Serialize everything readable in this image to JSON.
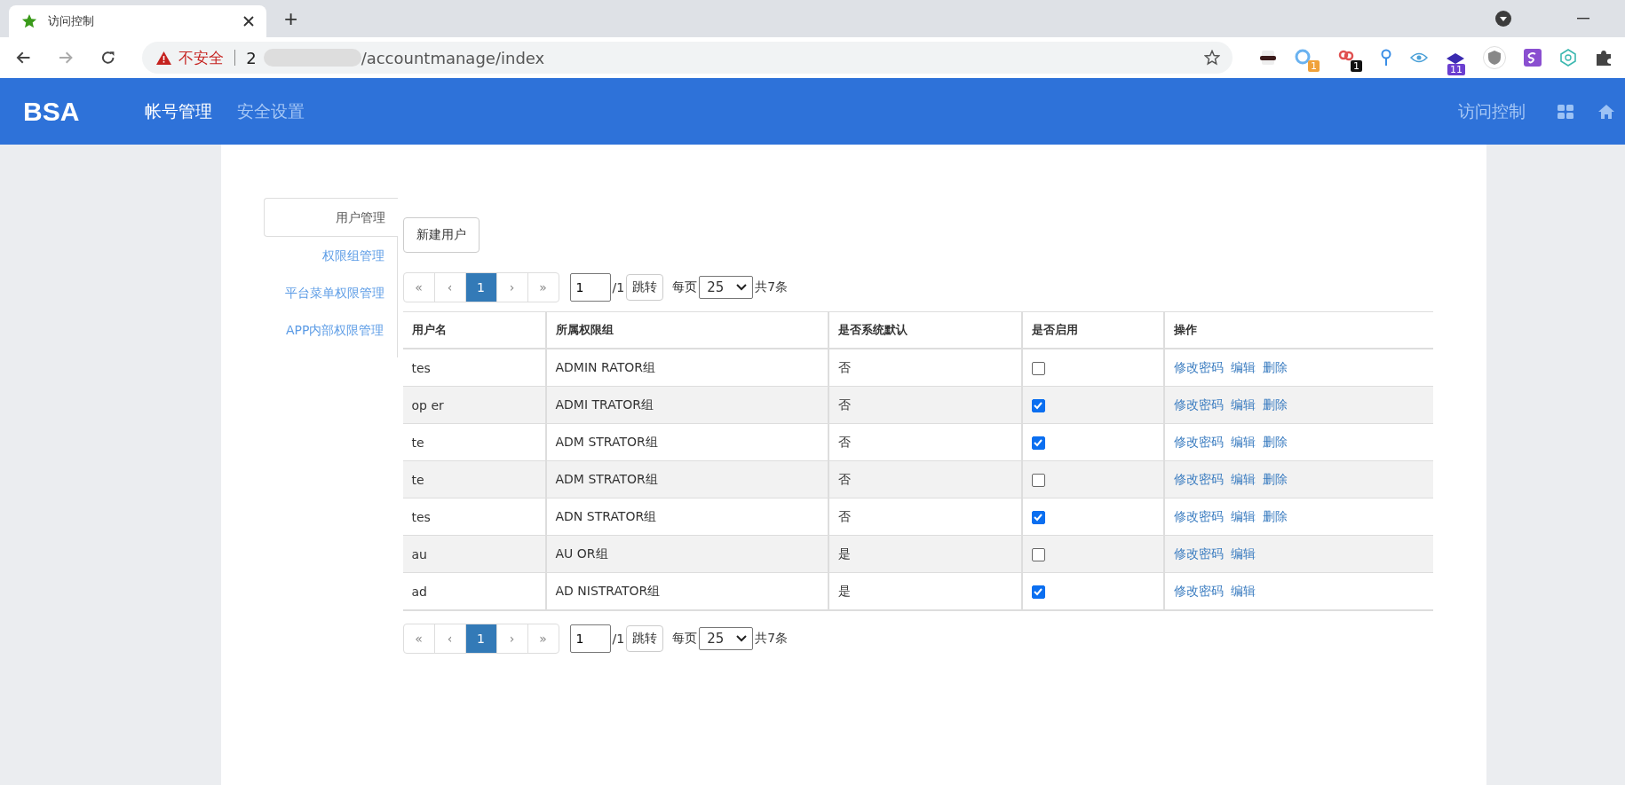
{
  "browser": {
    "tab_title": "访问控制",
    "new_tab": "+",
    "url_warning": "不安全",
    "url_host": "2",
    "url_path": "/accountmanage/index",
    "extension_badges": [
      "1",
      "1",
      "11"
    ]
  },
  "header": {
    "logo": "BSA",
    "nav": [
      {
        "label": "帐号管理",
        "selected": true
      },
      {
        "label": "安全设置",
        "selected": false
      }
    ],
    "right_link": "访问控制"
  },
  "sidebar": {
    "items": [
      {
        "label": "用户管理",
        "selected": true
      },
      {
        "label": "权限组管理",
        "selected": false
      },
      {
        "label": "平台菜单权限管理",
        "selected": false
      },
      {
        "label": "APP内部权限管理",
        "selected": false
      }
    ]
  },
  "new_user_button": "新建用户",
  "paginations": [
    {
      "first": "«",
      "prev": "‹",
      "page": "1",
      "next": "›",
      "last": "»",
      "page_input": "1",
      "total_pages": "/1",
      "jump": "跳转",
      "per_page_label": "每页",
      "per_page": "25",
      "total": "共7条"
    },
    {
      "first": "«",
      "prev": "‹",
      "page": "1",
      "next": "›",
      "last": "»",
      "page_input": "1",
      "total_pages": "/1",
      "jump": "跳转",
      "per_page_label": "每页",
      "per_page": "25",
      "total": "共7条"
    }
  ],
  "table": {
    "columns": [
      "用户名",
      "所属权限组",
      "是否系统默认",
      "是否启用",
      "操作"
    ],
    "rows": [
      {
        "username": "tes",
        "group": "ADMIN RATOR组",
        "default": "否",
        "enabled": false,
        "actions": [
          "修改密码",
          "编辑",
          "删除"
        ]
      },
      {
        "username": "op er",
        "group": "ADMI TRATOR组",
        "default": "否",
        "enabled": true,
        "actions": [
          "修改密码",
          "编辑",
          "删除"
        ]
      },
      {
        "username": "te",
        "group": "ADM STRATOR组",
        "default": "否",
        "enabled": true,
        "actions": [
          "修改密码",
          "编辑",
          "删除"
        ]
      },
      {
        "username": "te",
        "group": "ADM STRATOR组",
        "default": "否",
        "enabled": false,
        "actions": [
          "修改密码",
          "编辑",
          "删除"
        ]
      },
      {
        "username": "tes",
        "group": "ADN STRATOR组",
        "default": "否",
        "enabled": true,
        "actions": [
          "修改密码",
          "编辑",
          "删除"
        ]
      },
      {
        "username": "au",
        "group": "AU OR组",
        "default": "是",
        "enabled": false,
        "actions": [
          "修改密码",
          "编辑"
        ]
      },
      {
        "username": "ad",
        "group": "AD NISTRATOR组",
        "default": "是",
        "enabled": true,
        "actions": [
          "修改密码",
          "编辑"
        ]
      }
    ]
  }
}
